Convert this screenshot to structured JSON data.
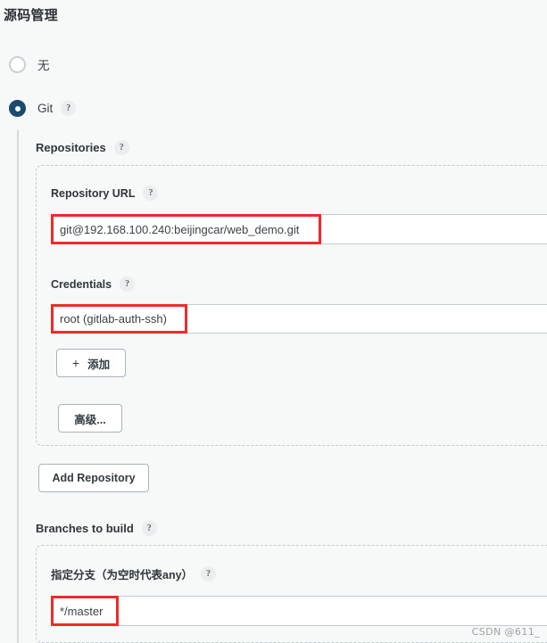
{
  "section": {
    "title": "源码管理"
  },
  "scm_options": [
    {
      "label": "无",
      "selected": false
    },
    {
      "label": "Git",
      "selected": true,
      "help": "?"
    }
  ],
  "repositories": {
    "label": "Repositories",
    "help": "?",
    "repository_url": {
      "label": "Repository URL",
      "help": "?",
      "value": "git@192.168.100.240:beijingcar/web_demo.git",
      "placeholder": ""
    },
    "credentials": {
      "label": "Credentials",
      "help": "?",
      "value": "root (gitlab-auth-ssh)"
    },
    "add_credential_button": {
      "plus": "+",
      "label": "添加"
    },
    "advanced_button": {
      "label": "高级..."
    }
  },
  "add_repository_button": {
    "label": "Add Repository"
  },
  "branches": {
    "label": "Branches to build",
    "help": "?",
    "branch_specifier": {
      "label": "指定分支（为空时代表any）",
      "help": "?",
      "value": "*/master",
      "placeholder": ""
    }
  },
  "watermark": {
    "text": "CSDN @611_"
  },
  "colors": {
    "page_background": "#f7f8f8",
    "radio_selected": "#1c4a6e",
    "annotation_red": "#ef2a2a",
    "border_gray": "#c3ccd2",
    "button_border": "#a8b4bc",
    "text": "#333b3f"
  }
}
